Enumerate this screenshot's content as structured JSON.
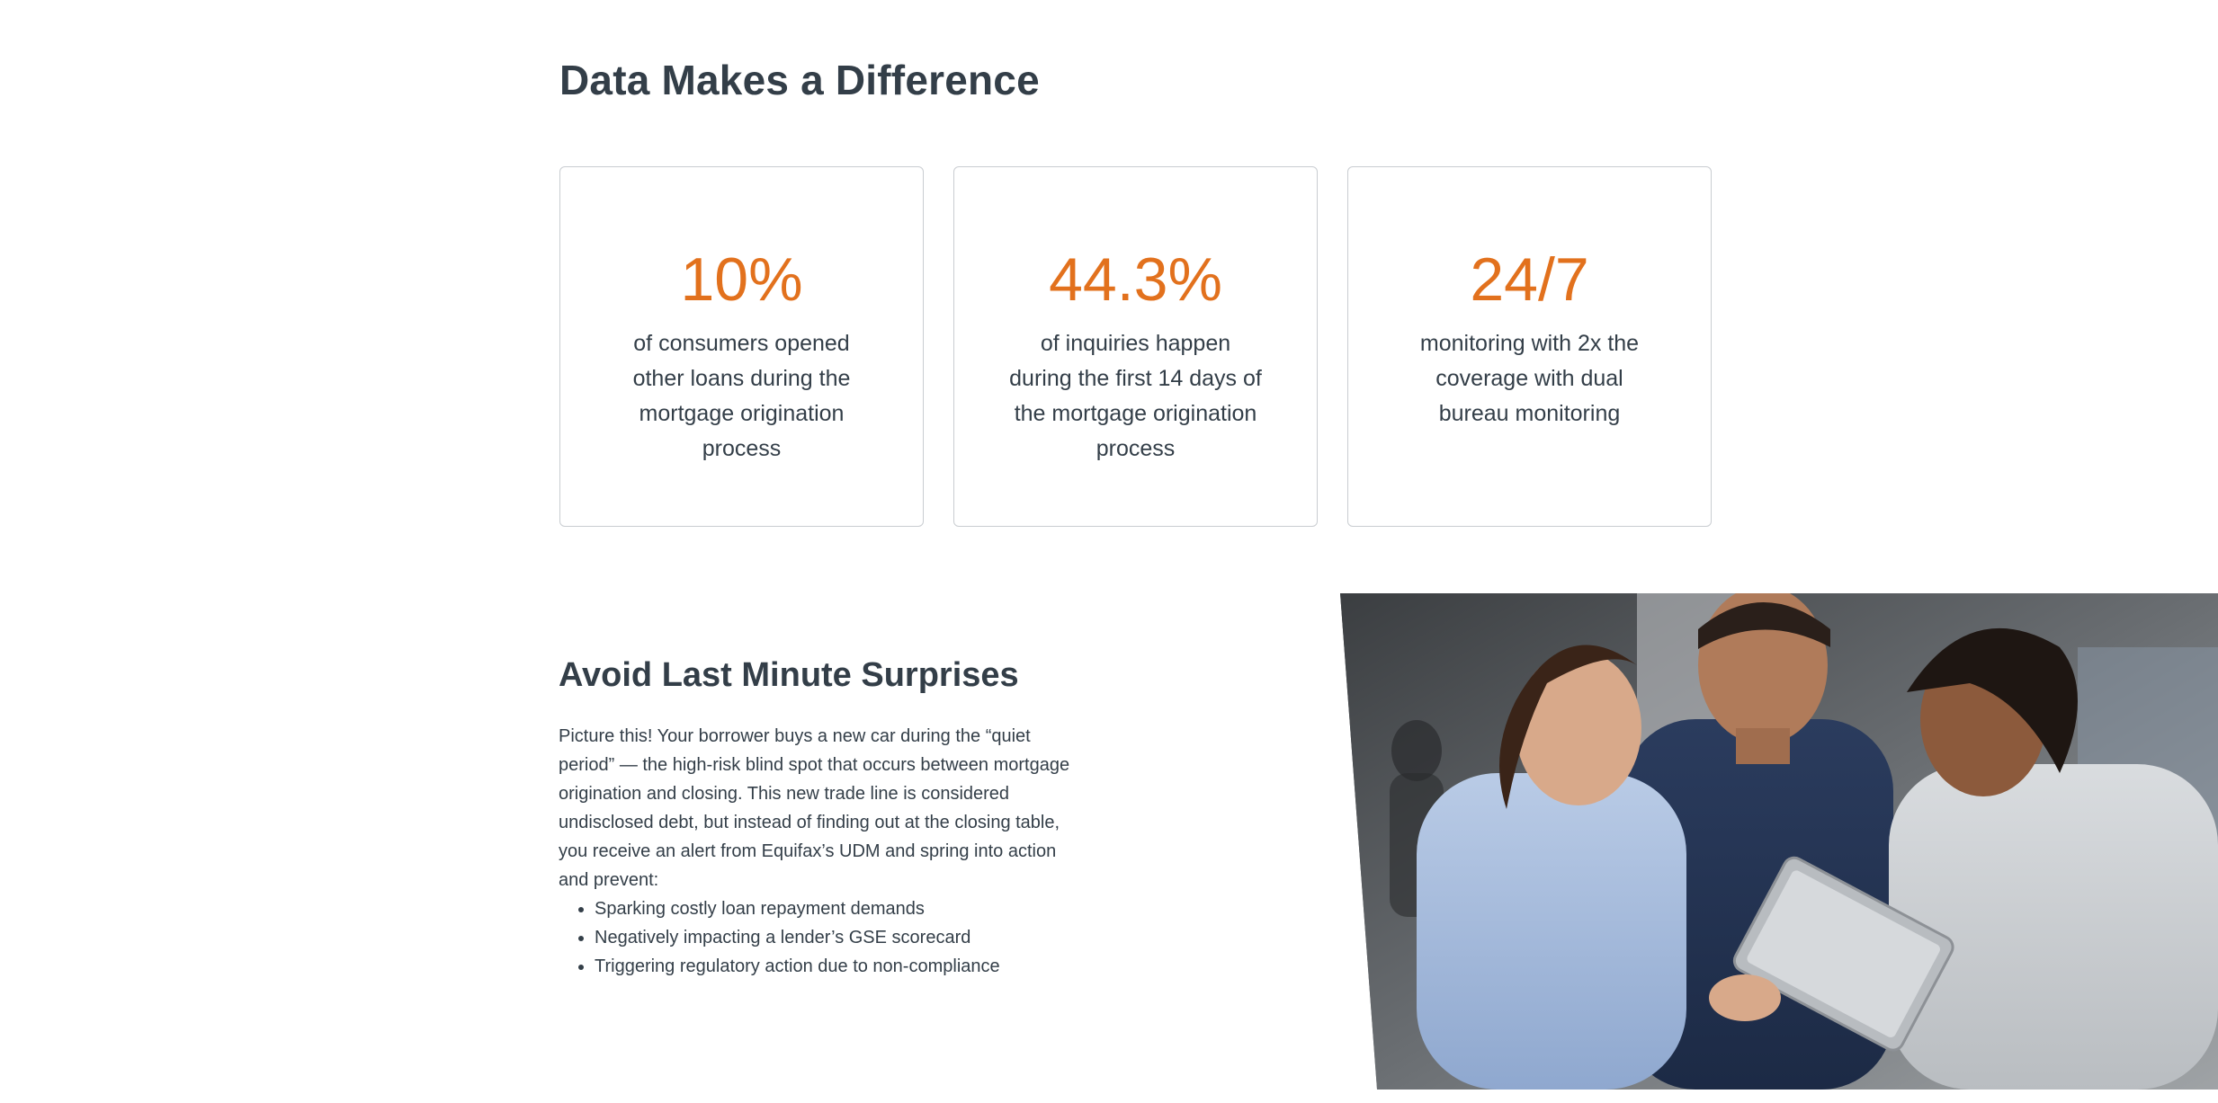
{
  "stats_section": {
    "title": "Data Makes a Difference",
    "cards": [
      {
        "value": "10%",
        "description": "of consumers opened other loans during the mortgage origination process"
      },
      {
        "value": "44.3%",
        "description": "of inquiries happen during the first 14 days of the mortgage origination process"
      },
      {
        "value": "24/7",
        "description": "monitoring with 2x the coverage with dual bureau monitoring"
      }
    ],
    "accent_color": "#e2711d"
  },
  "surprises_section": {
    "title": "Avoid Last Minute Surprises",
    "paragraph": "Picture this! Your borrower buys a new car during the “quiet period” — the high-risk blind spot that occurs between mortgage origination and closing. This new trade line is considered undisclosed debt, but instead of finding out at the closing table, you receive an alert from Equifax’s UDM and spring into action and prevent:",
    "bullets": [
      " Sparking costly loan repayment demands",
      "Negatively impacting a lender’s GSE scorecard",
      "Triggering regulatory action due to non-compliance"
    ]
  },
  "photo": {
    "icon": "photo-three-people-with-tablet"
  },
  "colors": {
    "heading": "#333e48",
    "card_border": "#c9cdd1"
  }
}
